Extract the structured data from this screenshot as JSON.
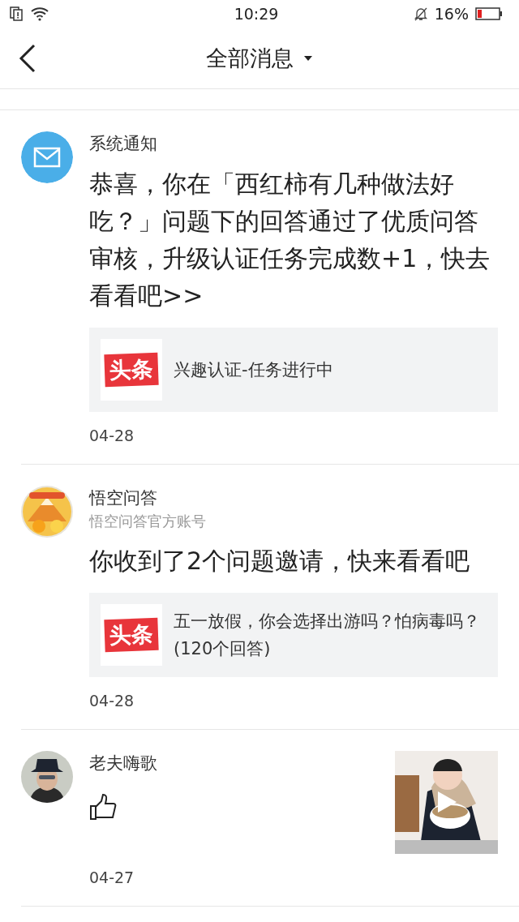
{
  "status_bar": {
    "time": "10:29",
    "battery": "16%"
  },
  "header": {
    "title": "全部消息"
  },
  "messages": [
    {
      "avatar": {
        "kind": "mail"
      },
      "sender": "系统通知",
      "text": "恭喜，你在「西红柿有几种做法好吃？」问题下的回答通过了优质问答审核，升级认证任务完成数+1，快去看看吧>>",
      "card": {
        "logo_text": "头条",
        "text": "兴趣认证-任务进行中"
      },
      "date": "04-28"
    },
    {
      "avatar": {
        "kind": "badge"
      },
      "sender": "悟空问答",
      "subtitle": "悟空问答官方账号",
      "text": "你收到了2个问题邀请，快来看看吧",
      "card": {
        "logo_text": "头条",
        "text": "五一放假，你会选择出游吗？怕病毒吗？(120个回答)"
      },
      "date": "04-28"
    },
    {
      "sender": "老夫嗨歌",
      "reaction": {
        "kind": "like"
      },
      "date": "04-27"
    }
  ]
}
